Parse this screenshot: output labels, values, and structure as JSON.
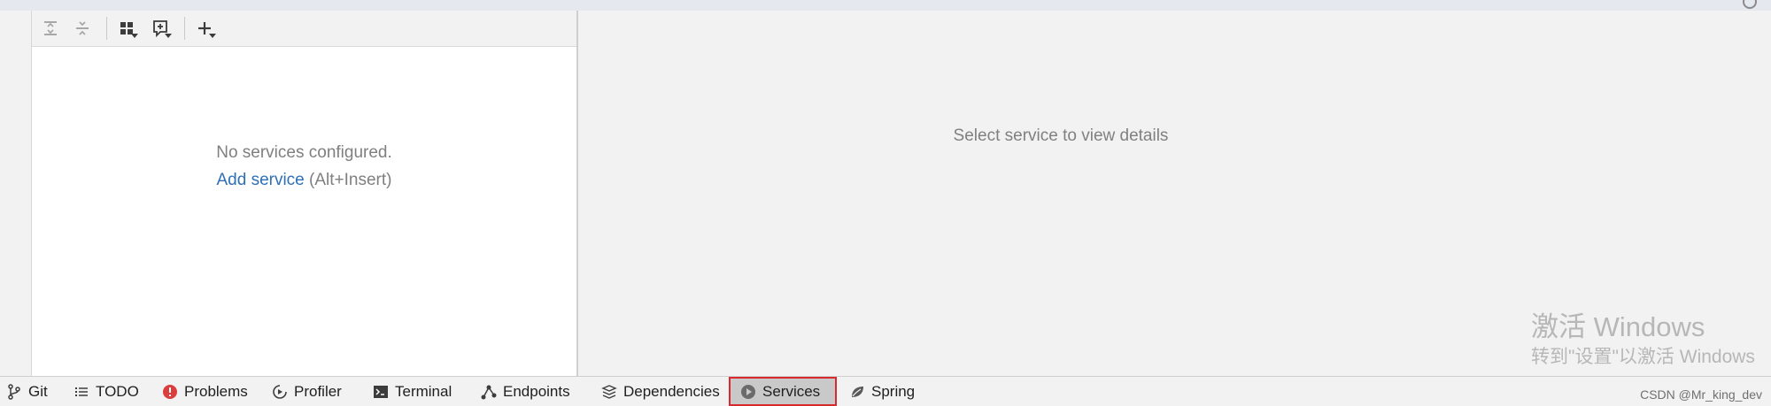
{
  "services": {
    "toolbar": {
      "expand_all_icon": "expand-all-icon",
      "collapse_all_icon": "collapse-all-icon",
      "group_by_icon": "group-by-icon",
      "new_group_icon": "new-group-icon",
      "add_icon": "add-icon"
    },
    "empty": {
      "message": "No services configured.",
      "add_link": "Add service",
      "shortcut": " (Alt+Insert)"
    }
  },
  "details": {
    "placeholder": "Select service to view details"
  },
  "watermark": {
    "line1": "激活 Windows",
    "line2": "转到\"设置\"以激活 Windows"
  },
  "bottom_tabs": [
    {
      "label": "Git",
      "icon": "git-branch-icon",
      "active": false
    },
    {
      "label": "TODO",
      "icon": "todo-list-icon",
      "active": false
    },
    {
      "label": "Problems",
      "icon": "problems-icon",
      "active": false
    },
    {
      "label": "Profiler",
      "icon": "profiler-icon",
      "active": false
    },
    {
      "label": "Terminal",
      "icon": "terminal-icon",
      "active": false
    },
    {
      "label": "Endpoints",
      "icon": "endpoints-icon",
      "active": false
    },
    {
      "label": "Dependencies",
      "icon": "dependencies-icon",
      "active": false
    },
    {
      "label": "Services",
      "icon": "services-icon",
      "active": true
    },
    {
      "label": "Spring",
      "icon": "spring-leaf-icon",
      "active": false
    }
  ],
  "credit": "CSDN @Mr_king_dev",
  "colors": {
    "accent_link": "#2f6fb5",
    "highlight_border": "#d8292f",
    "problems_red": "#db3d3d"
  }
}
